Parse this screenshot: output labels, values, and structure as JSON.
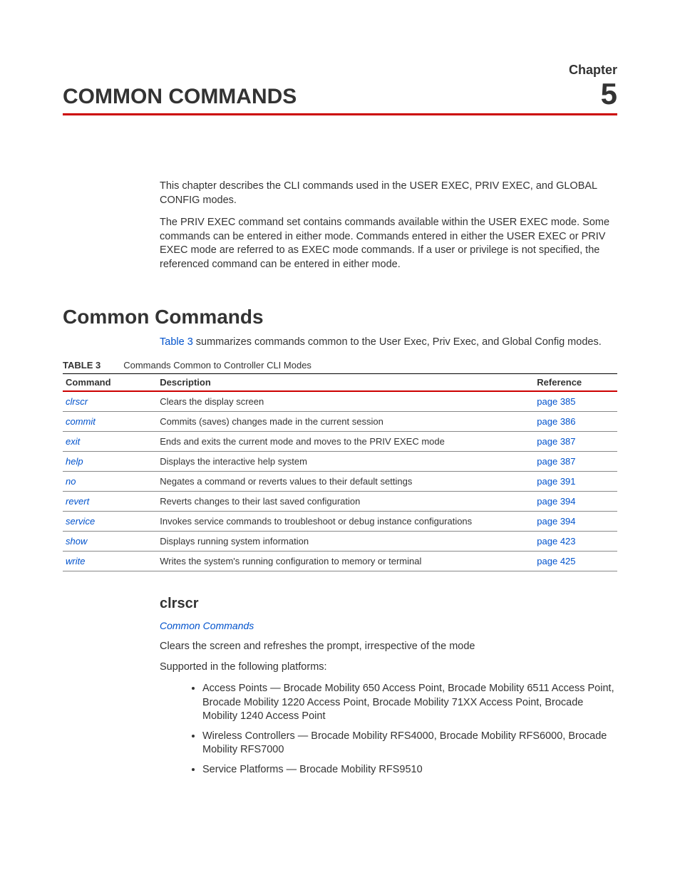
{
  "chapter": {
    "label": "Chapter",
    "number": "5",
    "title": "COMMON COMMANDS"
  },
  "intro": {
    "p1": "This chapter describes the CLI commands used in the USER EXEC, PRIV EXEC, and GLOBAL CONFIG modes.",
    "p2": "The PRIV EXEC command set contains commands available within the USER EXEC mode. Some commands can be entered in either mode. Commands entered in either the USER EXEC or PRIV EXEC mode are referred to as EXEC mode commands. If a user or privilege is not specified, the referenced command can be entered in either mode."
  },
  "section": {
    "heading": "Common Commands",
    "summary_prefix": "Table 3",
    "summary_rest": " summarizes commands common to the User Exec, Priv Exec, and Global Config modes."
  },
  "table": {
    "label": "TABLE 3",
    "caption": "Commands Common to Controller CLI Modes",
    "headers": {
      "command": "Command",
      "description": "Description",
      "reference": "Reference"
    },
    "rows": [
      {
        "cmd": "clrscr",
        "desc": "Clears the display screen",
        "ref": "page 385"
      },
      {
        "cmd": "commit",
        "desc": "Commits (saves) changes made in the current session",
        "ref": "page 386"
      },
      {
        "cmd": "exit",
        "desc": "Ends and exits the current mode and moves to the PRIV EXEC mode",
        "ref": "page 387"
      },
      {
        "cmd": "help",
        "desc": "Displays the interactive help system",
        "ref": "page 387"
      },
      {
        "cmd": "no",
        "desc": "Negates a command or reverts values to their default settings",
        "ref": "page 391"
      },
      {
        "cmd": "revert",
        "desc": "Reverts changes to their last saved configuration",
        "ref": "page 394"
      },
      {
        "cmd": "service",
        "desc": "Invokes service commands to troubleshoot or debug                         instance configurations",
        "ref": "page 394"
      },
      {
        "cmd": "show",
        "desc": "Displays running system information",
        "ref": "page 423"
      },
      {
        "cmd": "write",
        "desc": "Writes the system's running configuration to memory or terminal",
        "ref": "page 425"
      }
    ]
  },
  "clrscr": {
    "heading": "clrscr",
    "breadcrumb": "Common Commands",
    "desc": "Clears the screen and refreshes the prompt, irrespective of the mode",
    "supported_label": "Supported in the following platforms:",
    "platforms": [
      "Access Points — Brocade Mobility 650 Access Point, Brocade Mobility 6511 Access Point, Brocade Mobility 1220 Access Point, Brocade Mobility 71XX Access Point, Brocade Mobility 1240 Access Point",
      "Wireless Controllers — Brocade Mobility RFS4000, Brocade Mobility RFS6000, Brocade Mobility RFS7000",
      "Service Platforms — Brocade Mobility RFS9510"
    ]
  }
}
